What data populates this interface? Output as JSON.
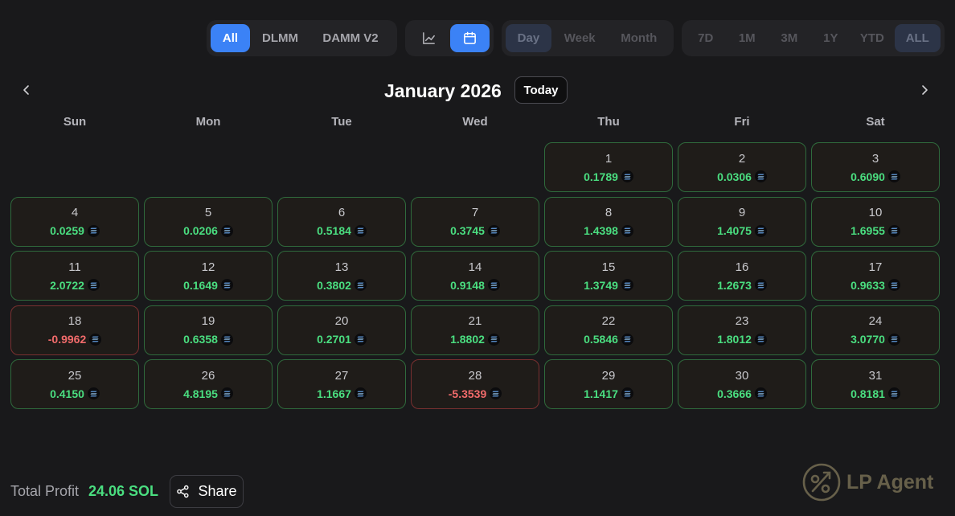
{
  "filters": {
    "protocol": {
      "options": [
        "All",
        "DLMM",
        "DAMM V2"
      ],
      "selected": "All"
    },
    "view": {
      "options": [
        {
          "icon": "line-chart-icon"
        },
        {
          "icon": "calendar-icon"
        }
      ],
      "selected": "calendar-icon"
    },
    "period": {
      "options": [
        "Day",
        "Week",
        "Month"
      ],
      "selected": "Day"
    },
    "range": {
      "options": [
        "7D",
        "1M",
        "3M",
        "1Y",
        "YTD",
        "ALL"
      ],
      "selected": "ALL"
    }
  },
  "calendar": {
    "month_label": "January 2026",
    "today_label": "Today",
    "prev_icon": "chevron-left-icon",
    "next_icon": "chevron-right-icon",
    "weekdays": [
      "Sun",
      "Mon",
      "Tue",
      "Wed",
      "Thu",
      "Fri",
      "Sat"
    ],
    "first_weekday_index": 4,
    "days": [
      {
        "day": "1",
        "pnl": "0.1789"
      },
      {
        "day": "2",
        "pnl": "0.0306"
      },
      {
        "day": "3",
        "pnl": "0.6090"
      },
      {
        "day": "4",
        "pnl": "0.0259"
      },
      {
        "day": "5",
        "pnl": "0.0206"
      },
      {
        "day": "6",
        "pnl": "0.5184"
      },
      {
        "day": "7",
        "pnl": "0.3745"
      },
      {
        "day": "8",
        "pnl": "1.4398"
      },
      {
        "day": "9",
        "pnl": "1.4075"
      },
      {
        "day": "10",
        "pnl": "1.6955"
      },
      {
        "day": "11",
        "pnl": "2.0722"
      },
      {
        "day": "12",
        "pnl": "0.1649"
      },
      {
        "day": "13",
        "pnl": "0.3802"
      },
      {
        "day": "14",
        "pnl": "0.9148"
      },
      {
        "day": "15",
        "pnl": "1.3749"
      },
      {
        "day": "16",
        "pnl": "1.2673"
      },
      {
        "day": "17",
        "pnl": "0.9633"
      },
      {
        "day": "18",
        "pnl": "-0.9962"
      },
      {
        "day": "19",
        "pnl": "0.6358"
      },
      {
        "day": "20",
        "pnl": "0.2701"
      },
      {
        "day": "21",
        "pnl": "1.8802"
      },
      {
        "day": "22",
        "pnl": "0.5846"
      },
      {
        "day": "23",
        "pnl": "1.8012"
      },
      {
        "day": "24",
        "pnl": "3.0770"
      },
      {
        "day": "25",
        "pnl": "0.4150"
      },
      {
        "day": "26",
        "pnl": "4.8195"
      },
      {
        "day": "27",
        "pnl": "1.1667"
      },
      {
        "day": "28",
        "pnl": "-5.3539"
      },
      {
        "day": "29",
        "pnl": "1.1417"
      },
      {
        "day": "30",
        "pnl": "0.3666"
      },
      {
        "day": "31",
        "pnl": "0.8181"
      }
    ],
    "token_icon": "solana-icon"
  },
  "footer": {
    "total_label": "Total Profit",
    "total_value": "24.06 SOL",
    "share_label": "Share",
    "share_icon": "share-icon",
    "brand_name": "LP Agent",
    "brand_icon": "lp-agent-logo-icon"
  },
  "colors": {
    "background": "#19191b",
    "accent": "#3b82f6",
    "profit": "#4ade80",
    "loss": "#f26b6b",
    "profit_border": "#2f6a3c",
    "loss_border": "#7a3030"
  }
}
